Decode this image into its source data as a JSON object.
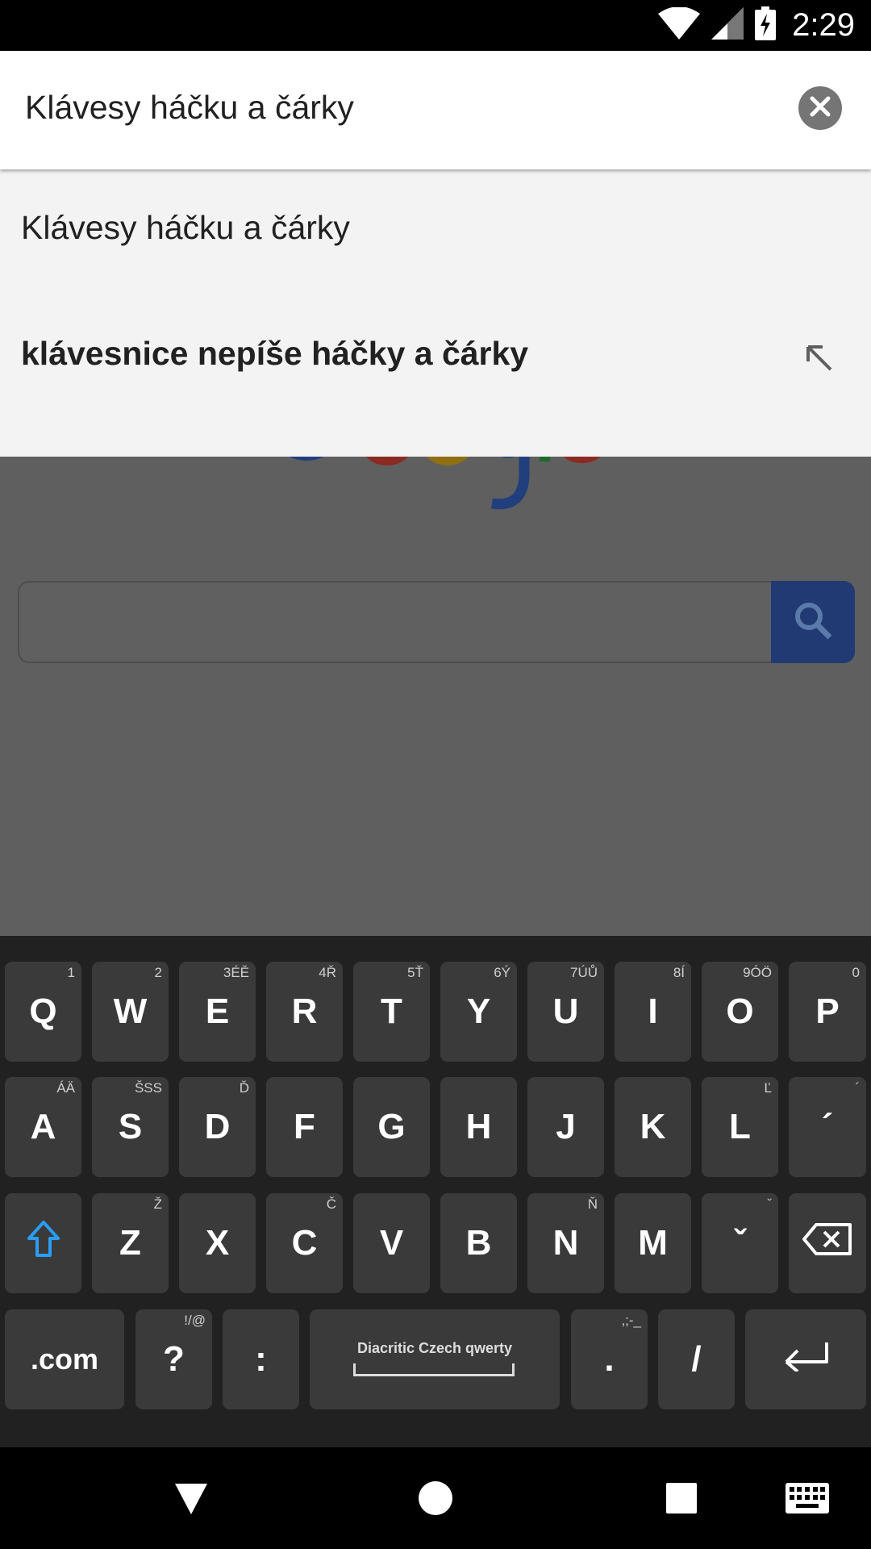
{
  "status_bar": {
    "time": "2:29",
    "icons": [
      "wifi-icon",
      "signal-icon",
      "battery-charging-icon"
    ]
  },
  "search": {
    "query": "Klávesy háčku a čárky",
    "clear_icon": "close-icon"
  },
  "suggestions": [
    {
      "text": "Klávesy háčku a čárky",
      "bold": false,
      "icon": null
    },
    {
      "text": "klávesnice nepíše háčky a čárky",
      "bold": true,
      "icon": "arrow-up-left-icon"
    }
  ],
  "background_page": {
    "logo_text": "Google",
    "search_button_icon": "search-icon"
  },
  "keyboard": {
    "layout_name": "Diacritic Czech qwerty",
    "rows": [
      [
        {
          "label": "Q",
          "hint": "1"
        },
        {
          "label": "W",
          "hint": "2"
        },
        {
          "label": "E",
          "hint": "3ÉĚ"
        },
        {
          "label": "R",
          "hint": "4Ř"
        },
        {
          "label": "T",
          "hint": "5Ť"
        },
        {
          "label": "Y",
          "hint": "6Ý"
        },
        {
          "label": "U",
          "hint": "7ÚŮ"
        },
        {
          "label": "I",
          "hint": "8Í"
        },
        {
          "label": "O",
          "hint": "9ÓÖ"
        },
        {
          "label": "P",
          "hint": "0"
        }
      ],
      [
        {
          "label": "A",
          "hint": "ÁÄ"
        },
        {
          "label": "S",
          "hint": "ŠSS"
        },
        {
          "label": "D",
          "hint": "Ď"
        },
        {
          "label": "F",
          "hint": ""
        },
        {
          "label": "G",
          "hint": ""
        },
        {
          "label": "H",
          "hint": ""
        },
        {
          "label": "J",
          "hint": ""
        },
        {
          "label": "K",
          "hint": ""
        },
        {
          "label": "L",
          "hint": "Ľ"
        },
        {
          "label": "´",
          "hint": "´"
        }
      ],
      [
        {
          "label": "Z",
          "hint": "Ž"
        },
        {
          "label": "X",
          "hint": ""
        },
        {
          "label": "C",
          "hint": "Č"
        },
        {
          "label": "V",
          "hint": ""
        },
        {
          "label": "B",
          "hint": ""
        },
        {
          "label": "N",
          "hint": "Ň"
        },
        {
          "label": "M",
          "hint": ""
        },
        {
          "label": "ˇ",
          "hint": "ˇ"
        }
      ],
      [
        {
          "label": ".com",
          "hint": ""
        },
        {
          "label": "?",
          "hint": "!/@"
        },
        {
          "label": ":",
          "hint": ""
        },
        {
          "label": ".",
          "hint": ",;-_"
        },
        {
          "label": "/",
          "hint": ""
        }
      ]
    ],
    "shift_icon": "shift-icon",
    "backspace_icon": "backspace-icon",
    "enter_icon": "enter-icon",
    "accent_color": "#2a9df4"
  },
  "nav_bar": {
    "icons": [
      "back-icon",
      "home-icon",
      "recents-icon",
      "keyboard-switch-icon"
    ]
  }
}
